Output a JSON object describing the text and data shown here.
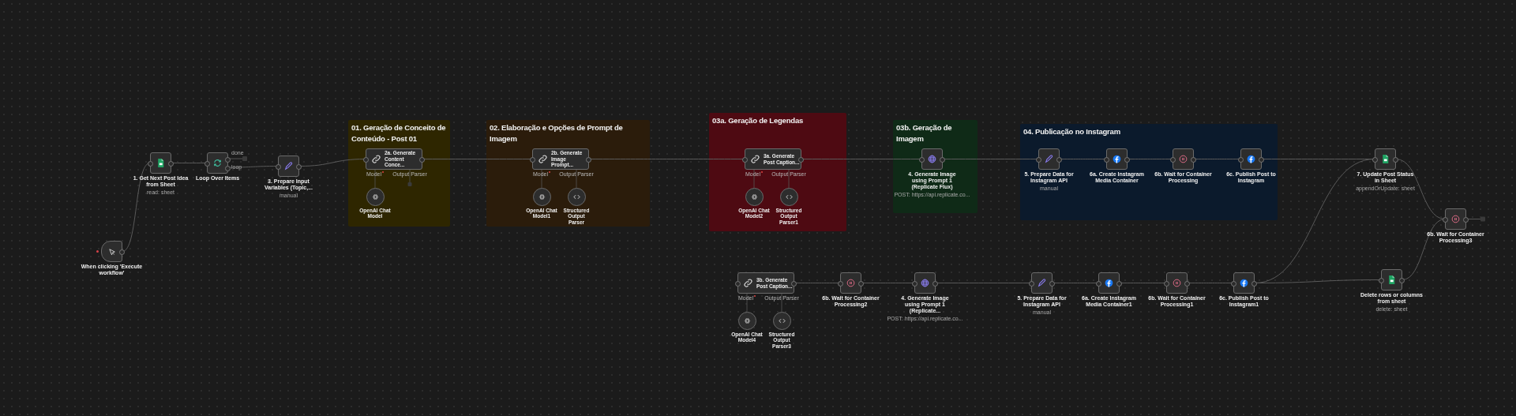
{
  "canvas": {
    "sections": [
      {
        "title": "01. Geração de Conceito de Conteúdo - Post 01",
        "color": "#2e2600"
      },
      {
        "title": "02. Elaboração e Opções de Prompt de Imagem",
        "color": "#2b1c0b"
      },
      {
        "title": "03a. Geração de Legendas",
        "color": "#4e0a12"
      },
      {
        "title": "03b. Geração de Imagem",
        "color": "#0f2a17"
      },
      {
        "title": "04. Publicação no Instagram",
        "color": "#0b1a2c"
      }
    ],
    "nodes": [
      {
        "kind": "trigger",
        "label": "When clicking 'Execute workflow'"
      },
      {
        "kind": "sheet",
        "label": "1. Get Next Post Idea from Sheet",
        "subtitle": "read: sheet"
      },
      {
        "kind": "loop",
        "label": "Loop Over Items",
        "outputs": [
          "done",
          "loop"
        ]
      },
      {
        "kind": "edit",
        "label": "3. Prepare Input Variables (Topic,...",
        "subtitle": "manual"
      },
      {
        "kind": "agent",
        "label": "2a. Generate Content Conce...",
        "ports": [
          {
            "label": "Model",
            "required": true
          },
          {
            "label": "Output Parser",
            "required": false
          }
        ],
        "sub_nodes": [
          {
            "kind": "model",
            "label": "OpenAI Chat Model"
          }
        ]
      },
      {
        "kind": "agent",
        "label": "2b. Generate Image Prompt...",
        "ports": [
          {
            "label": "Model",
            "required": true
          },
          {
            "label": "Output Parser",
            "required": false
          }
        ],
        "sub_nodes": [
          {
            "kind": "model",
            "label": "OpenAI Chat Model1"
          },
          {
            "kind": "parser",
            "label": "Structured Output Parser"
          }
        ]
      },
      {
        "kind": "agent",
        "label": "3a. Generate Post Caption...",
        "ports": [
          {
            "label": "Model",
            "required": true
          },
          {
            "label": "Output Parser",
            "required": false
          }
        ],
        "sub_nodes": [
          {
            "kind": "model",
            "label": "OpenAI Chat Model2"
          },
          {
            "kind": "parser",
            "label": "Structured Output Parser1"
          }
        ]
      },
      {
        "kind": "http",
        "label": "4. Generate Image using Prompt 1 (Replicate Flux)",
        "subtitle": "POST: https://api.replicate.co..."
      },
      {
        "kind": "edit",
        "label": "5. Prepare Data for Instagram API",
        "subtitle": "manual"
      },
      {
        "kind": "facebook",
        "label": "6a. Create Instagram Media Container"
      },
      {
        "kind": "wait",
        "label": "6b. Wait for Container Processing"
      },
      {
        "kind": "facebook",
        "label": "6c. Publish Post to Instagram"
      },
      {
        "kind": "sheet",
        "label": "7. Update Post Status in Sheet",
        "subtitle": "appendOrUpdate: sheet"
      },
      {
        "kind": "wait",
        "label": "6b. Wait for Container Processing3"
      },
      {
        "kind": "agent",
        "label": "3b. Generate Post Caption...",
        "ports": [
          {
            "label": "Model",
            "required": true
          },
          {
            "label": "Output Parser",
            "required": false
          }
        ],
        "sub_nodes": [
          {
            "kind": "model",
            "label": "OpenAI Chat Model4"
          },
          {
            "kind": "parser",
            "label": "Structured Output Parser3"
          }
        ]
      },
      {
        "kind": "wait",
        "label": "6b. Wait for Container Processing2"
      },
      {
        "kind": "http",
        "label": "4. Generate Image using Prompt 1 (Replicate...",
        "subtitle": "POST: https://api.replicate.co..."
      },
      {
        "kind": "edit",
        "label": "5. Prepare Data for Instagram API",
        "subtitle": "manual"
      },
      {
        "kind": "facebook",
        "label": "6a. Create Instagram Media Container1"
      },
      {
        "kind": "wait",
        "label": "6b. Wait for Container Processing1"
      },
      {
        "kind": "facebook",
        "label": "6c. Publish Post to Instagram1"
      },
      {
        "kind": "sheet",
        "label": "Delete rows or columns from sheet",
        "subtitle": "delete: sheet"
      }
    ]
  }
}
